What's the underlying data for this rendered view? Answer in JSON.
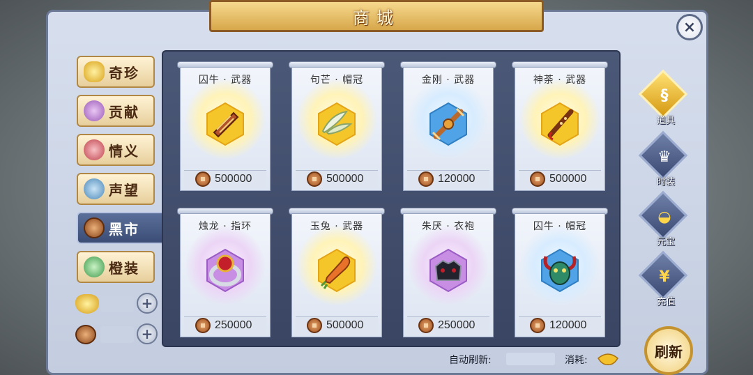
{
  "window": {
    "title": "商城",
    "close_label": "×"
  },
  "left_tabs": [
    {
      "label": "奇珍",
      "icon": "gold-ingot-icon",
      "active": false
    },
    {
      "label": "贡献",
      "icon": "purple-pouch-icon",
      "active": false
    },
    {
      "label": "情义",
      "icon": "red-pouch-icon",
      "active": false
    },
    {
      "label": "声望",
      "icon": "blue-pouch-icon",
      "active": false
    },
    {
      "label": "黑市",
      "icon": "copper-coin-icon",
      "active": true
    },
    {
      "label": "橙装",
      "icon": "green-jade-icon",
      "active": false
    }
  ],
  "currencies": [
    {
      "icon": "gold-ingot-icon",
      "plus": "+"
    },
    {
      "icon": "copper-coin-icon",
      "plus": "+"
    }
  ],
  "items": [
    {
      "name": "囚牛 · 武器",
      "price": "500000",
      "icon": "harp-weapon-icon"
    },
    {
      "name": "句芒 · 帽冠",
      "price": "500000",
      "icon": "feather-crown-icon"
    },
    {
      "name": "金刚 · 武器",
      "price": "120000",
      "icon": "vajra-weapon-icon"
    },
    {
      "name": "神荼 · 武器",
      "price": "500000",
      "icon": "flute-weapon-icon"
    },
    {
      "name": "烛龙 · 指环",
      "price": "250000",
      "icon": "ring-icon"
    },
    {
      "name": "玉兔 · 武器",
      "price": "500000",
      "icon": "carrot-weapon-icon"
    },
    {
      "name": "朱厌 · 衣袍",
      "price": "250000",
      "icon": "robe-icon"
    },
    {
      "name": "囚牛 · 帽冠",
      "price": "120000",
      "icon": "demon-mask-icon"
    }
  ],
  "categories": [
    {
      "label": "道具",
      "icon": "gourd-icon",
      "active": true
    },
    {
      "label": "时装",
      "icon": "helmet-icon",
      "active": false
    },
    {
      "label": "元宝",
      "icon": "ingot-icon",
      "active": false
    },
    {
      "label": "充值",
      "icon": "yen-icon",
      "active": false
    }
  ],
  "footer": {
    "auto_refresh_label": "自动刷新:",
    "cost_label": "消耗:",
    "refresh_button": "刷新"
  },
  "colors": {
    "accent_gold": "#d7a74a",
    "panel_blue": "#3a4563",
    "coin_copper": "#9a4e1f"
  }
}
